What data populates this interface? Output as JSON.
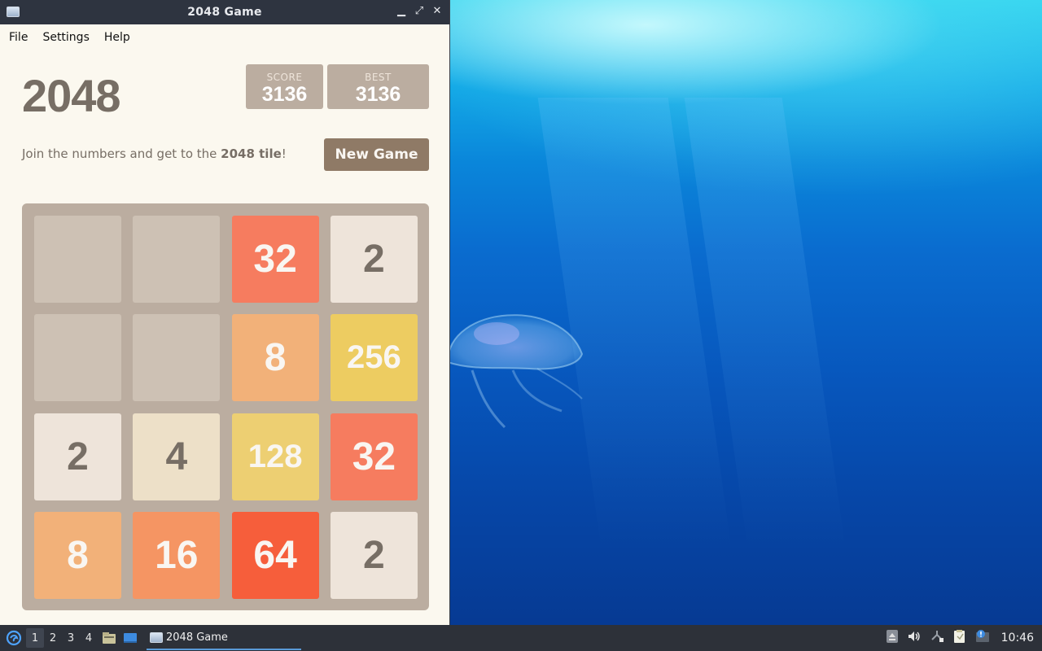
{
  "window": {
    "title": "2048 Game",
    "controls": {
      "minimize": "▁",
      "maximize": "⤢",
      "close": "✕"
    }
  },
  "menubar": {
    "items": [
      "File",
      "Settings",
      "Help"
    ]
  },
  "game": {
    "title": "2048",
    "score_label": "SCORE",
    "score_value": "3136",
    "best_label": "BEST",
    "best_value": "3136",
    "intro_prefix": "Join the numbers and get to the ",
    "intro_bold": "2048 tile",
    "intro_suffix": "!",
    "new_game_label": "New Game",
    "grid": [
      [
        null,
        null,
        32,
        2
      ],
      [
        null,
        null,
        8,
        256
      ],
      [
        2,
        4,
        128,
        32
      ],
      [
        8,
        16,
        64,
        2
      ]
    ]
  },
  "tile_colors": {
    "empty": "#cdc1b4",
    "2": "#eee4da",
    "4": "#ede0c8",
    "8": "#f2b179",
    "16": "#f59563",
    "32": "#f67c5f",
    "64": "#f65e3b",
    "128": "#edcf72",
    "256": "#edcc61"
  },
  "taskbar": {
    "workspaces": [
      "1",
      "2",
      "3",
      "4"
    ],
    "active_workspace": "1",
    "task_label": "2048 Game",
    "clock": "10:46",
    "tray_icons": [
      "eject-icon",
      "volume-icon",
      "network-icon",
      "clipboard-icon",
      "notification-icon"
    ]
  }
}
